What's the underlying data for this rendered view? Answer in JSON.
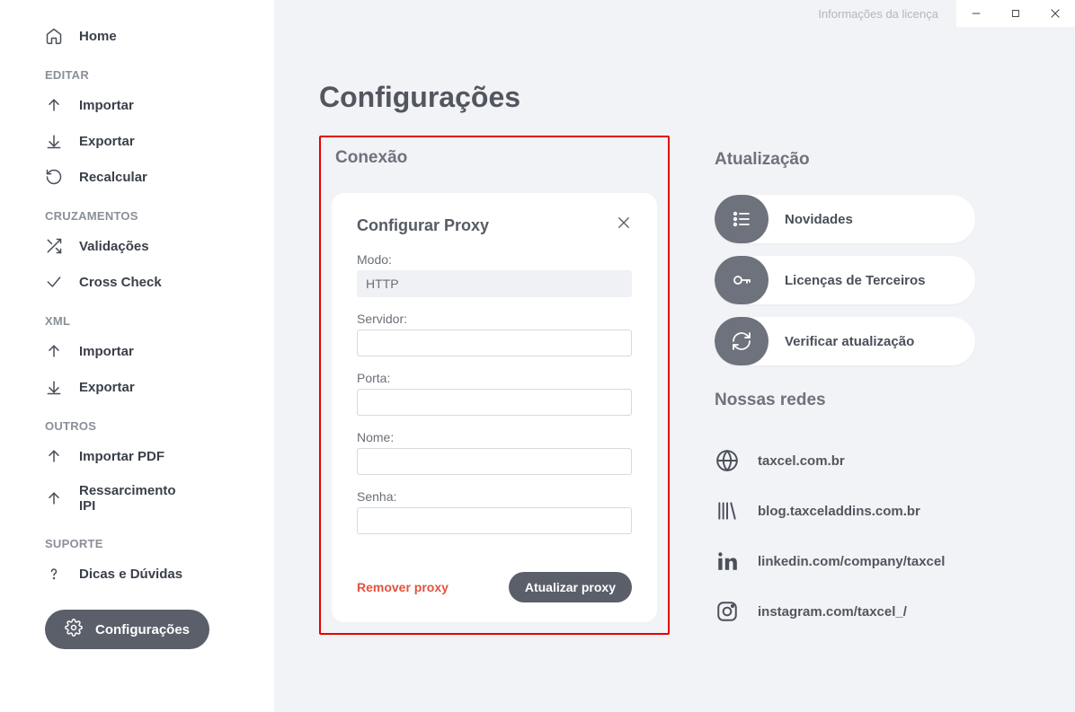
{
  "topbar": {
    "license_info": "Informações da licença"
  },
  "sidebar": {
    "home": "Home",
    "sections": {
      "editar": "EDITAR",
      "cruzamentos": "CRUZAMENTOS",
      "xml": "XML",
      "outros": "OUTROS",
      "suporte": "SUPORTE"
    },
    "items": {
      "importar": "Importar",
      "exportar": "Exportar",
      "recalcular": "Recalcular",
      "validacoes": "Validações",
      "cross_check": "Cross Check",
      "importar_xml": "Importar",
      "exportar_xml": "Exportar",
      "importar_pdf": "Importar PDF",
      "ressarcimento_ipi": "Ressarcimento IPI",
      "dicas": "Dicas e Dúvidas",
      "config": "Configurações"
    }
  },
  "page": {
    "title": "Configurações"
  },
  "conexao": {
    "title": "Conexão",
    "card_title": "Configurar Proxy",
    "labels": {
      "modo": "Modo:",
      "servidor": "Servidor:",
      "porta": "Porta:",
      "nome": "Nome:",
      "senha": "Senha:"
    },
    "values": {
      "modo": "HTTP",
      "servidor": "",
      "porta": "",
      "nome": "",
      "senha": ""
    },
    "remove_label": "Remover proxy",
    "update_label": "Atualizar proxy"
  },
  "atualizacao": {
    "title": "Atualização",
    "novidades": "Novidades",
    "licencas": "Licenças de Terceiros",
    "verificar": "Verificar atualização"
  },
  "redes": {
    "title": "Nossas redes",
    "web": "taxcel.com.br",
    "blog": "blog.taxceladdins.com.br",
    "linkedin": "linkedin.com/company/taxcel",
    "instagram": "instagram.com/taxcel_/"
  }
}
